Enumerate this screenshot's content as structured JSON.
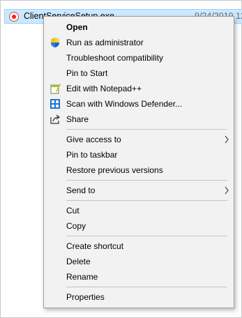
{
  "file": {
    "name": "ClientServiceSetup.exe",
    "date": "9/24/2019 12"
  },
  "menu": {
    "open": "Open",
    "run_as_admin": "Run as administrator",
    "troubleshoot": "Troubleshoot compatibility",
    "pin_to_start": "Pin to Start",
    "edit_notepad": "Edit with Notepad++",
    "scan_defender": "Scan with Windows Defender...",
    "share": "Share",
    "give_access": "Give access to",
    "pin_taskbar": "Pin to taskbar",
    "restore_versions": "Restore previous versions",
    "send_to": "Send to",
    "cut": "Cut",
    "copy": "Copy",
    "create_shortcut": "Create shortcut",
    "delete": "Delete",
    "rename": "Rename",
    "properties": "Properties"
  },
  "icons": {
    "file": "app-icon",
    "shield": "uac-shield-icon",
    "notepad": "notepad-plus-plus-icon",
    "defender": "windows-defender-icon",
    "share": "share-icon",
    "submenu": "chevron-right-icon"
  }
}
